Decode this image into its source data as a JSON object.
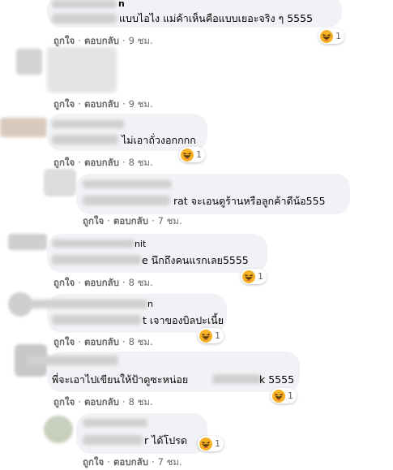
{
  "colors": {
    "bubble": "#f0f2f5",
    "action_text": "#65676b",
    "text": "#050505",
    "haha": "#f7b125"
  },
  "reaction_icon": "haha-emoji-icon",
  "comments": [
    {
      "name": "n",
      "text": "แบบไอไง แม่ค้าเห็นคือแบบเยอะจริง ๆ 5555",
      "like": "ถูกใจ",
      "reply": "ตอบกลับ",
      "time": "9 ชม.",
      "reactions": "1"
    },
    {
      "name": "",
      "text": "",
      "like": "ถูกใจ",
      "reply": "ตอบกลับ",
      "time": "9 ชม.",
      "reactions": ""
    },
    {
      "name": "",
      "text": "ไม่เอาถั่วงอกกกก",
      "like": "ถูกใจ",
      "reply": "ตอบกลับ",
      "time": "8 ชม.",
      "reactions": "1"
    },
    {
      "name": "",
      "text": "rat จะเอนดูร้านหรือลูกค้าดีน้อ555",
      "like": "ถูกใจ",
      "reply": "ตอบกลับ",
      "time": "7 ชม.",
      "reactions": ""
    },
    {
      "name": "nit",
      "text": "e นึกถึงคนแรกเลย5555",
      "like": "ถูกใจ",
      "reply": "ตอบกลับ",
      "time": "8 ชม.",
      "reactions": "1"
    },
    {
      "name": "n",
      "text": "t เจาของบิลปะเนี้ย",
      "like": "ถูกใจ",
      "reply": "ตอบกลับ",
      "time": "8 ชม.",
      "reactions": "1"
    },
    {
      "name": "",
      "text_a": "พี่จะเอาไปเขียนให้ป้าดูซะหน่อย",
      "text_b": "k 5555",
      "like": "ถูกใจ",
      "reply": "ตอบกลับ",
      "time": "8 ชม.",
      "reactions": "1"
    },
    {
      "name": "",
      "text": "r ได้โปรด",
      "like": "ถูกใจ",
      "reply": "ตอบกลับ",
      "time": "7 ชม.",
      "reactions": "1"
    }
  ],
  "separator": "·"
}
